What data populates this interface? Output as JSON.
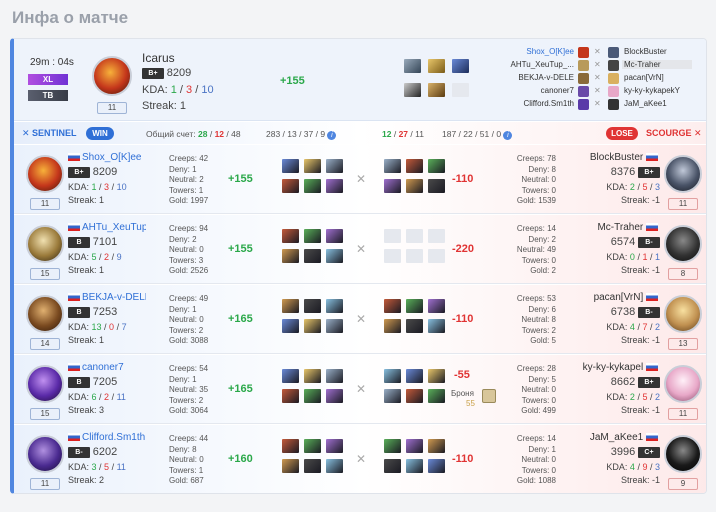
{
  "page_title": "Инфа о матче",
  "header": {
    "duration": "29m : 04s",
    "tags": [
      "XL",
      "TB"
    ],
    "player": {
      "name": "Icarus",
      "rank": "B+",
      "rating": "8209",
      "kda_label": "KDA:",
      "kills": "1",
      "deaths": "3",
      "assists": "10",
      "streak": "Streak: 1",
      "level": "11",
      "gain": "+155"
    },
    "players_sentinel": [
      "Shox_O[K]ee",
      "AHTu_XeuTup_...",
      "BEKJA-v-DELE",
      "canoner7",
      "Clifford.Sm1th"
    ],
    "players_scourge": [
      "BlockBuster",
      "Mc-Traher",
      "pacan[VrN]",
      "ky-ky-kykapekY",
      "JaM_aKee1"
    ]
  },
  "teams": {
    "sentinel": "SENTINEL",
    "win": "WIN",
    "score_label": "Общий счет:",
    "s_k": "28",
    "s_d": "12",
    "s_a": "48",
    "s_extra": "283 / 13 / 37 / 9",
    "c_k": "12",
    "c_d": "27",
    "c_a": "11",
    "c_extra": "187 / 22 / 51 / 0",
    "lose": "LOSE",
    "scourge": "SCOURGE"
  },
  "rows": [
    {
      "left": {
        "name": "Shox_O[K]ee",
        "rank": "B+",
        "rating": "8209",
        "k": "1",
        "d": "3",
        "a": "10",
        "streak": "Streak: 1",
        "level": "11",
        "creeps": "Creeps: 42",
        "deny": "Deny: 1",
        "neutral": "Neutral: 2",
        "towers": "Towers: 1",
        "gold": "Gold: 1997",
        "gain": "+155"
      },
      "right": {
        "name": "BlockBuster",
        "rank": "B+",
        "rating": "8376",
        "k": "2",
        "d": "5",
        "a": "3",
        "streak": "Streak: -1",
        "level": "11",
        "creeps": "Creeps: 78",
        "deny": "Deny: 8",
        "neutral": "Neutral: 0",
        "towers": "Towers: 0",
        "gold": "Gold: 1539",
        "gain": "-110"
      }
    },
    {
      "left": {
        "name": "AHTu_XeuTup",
        "rank": "B",
        "rating": "7101",
        "k": "5",
        "d": "2",
        "a": "9",
        "streak": "Streak: 1",
        "level": "15",
        "creeps": "Creeps: 94",
        "deny": "Deny: 2",
        "neutral": "Neutral: 0",
        "towers": "Towers: 3",
        "gold": "Gold: 2526",
        "gain": "+155"
      },
      "right": {
        "name": "Mc-Traher",
        "rank": "B-",
        "rating": "6574",
        "k": "0",
        "d": "1",
        "a": "1",
        "streak": "Streak: -1",
        "level": "8",
        "creeps": "Creeps: 14",
        "deny": "Deny: 2",
        "neutral": "Neutral: 49",
        "towers": "Towers: 0",
        "gold": "Gold: 2",
        "gain": "-220"
      }
    },
    {
      "left": {
        "name": "BEKJA-v-DELE",
        "rank": "B",
        "rating": "7253",
        "k": "13",
        "d": "0",
        "a": "7",
        "streak": "Streak: 1",
        "level": "14",
        "creeps": "Creeps: 49",
        "deny": "Deny: 1",
        "neutral": "Neutral: 0",
        "towers": "Towers: 2",
        "gold": "Gold: 3088",
        "gain": "+165"
      },
      "right": {
        "name": "pacan[VrN]",
        "rank": "B-",
        "rating": "6738",
        "k": "4",
        "d": "7",
        "a": "2",
        "streak": "Streak: -1",
        "level": "13",
        "creeps": "Creeps: 53",
        "deny": "Deny: 6",
        "neutral": "Neutral: 8",
        "towers": "Towers: 2",
        "gold": "Gold: 5",
        "gain": "-110"
      }
    },
    {
      "left": {
        "name": "canoner7",
        "rank": "B",
        "rating": "7205",
        "k": "6",
        "d": "2",
        "a": "11",
        "streak": "Streak: 3",
        "level": "15",
        "creeps": "Creeps: 54",
        "deny": "Deny: 1",
        "neutral": "Neutral: 35",
        "towers": "Towers: 2",
        "gold": "Gold: 3064",
        "gain": "+165"
      },
      "right": {
        "name": "ky-ky-kykapel",
        "rank": "B+",
        "rating": "8662",
        "k": "2",
        "d": "5",
        "a": "2",
        "streak": "Streak: -1",
        "level": "11",
        "creeps": "Creeps: 28",
        "deny": "Deny: 5",
        "neutral": "Neutral: 0",
        "towers": "Towers: 0",
        "gold": "Gold: 499",
        "gain": "-55",
        "armor_label": "Броня",
        "armor": "55"
      }
    },
    {
      "left": {
        "name": "Clifford.Sm1th",
        "rank": "B-",
        "rating": "6202",
        "k": "3",
        "d": "5",
        "a": "11",
        "streak": "Streak: 2",
        "level": "11",
        "creeps": "Creeps: 44",
        "deny": "Deny: 8",
        "neutral": "Neutral: 0",
        "towers": "Towers: 1",
        "gold": "Gold: 687",
        "gain": "+160"
      },
      "right": {
        "name": "JaM_aKee1",
        "rank": "C+",
        "rating": "3996",
        "k": "4",
        "d": "9",
        "a": "3",
        "streak": "Streak: -1",
        "level": "9",
        "creeps": "Creeps: 14",
        "deny": "Deny: 1",
        "neutral": "Neutral: 0",
        "towers": "Towers: 0",
        "gold": "Gold: 1088",
        "gain": "-110"
      }
    }
  ],
  "kda_label": "KDA:",
  "colors": {
    "accent": "#4f86e0",
    "win": "#2ba84a",
    "loss": "#e03434"
  }
}
